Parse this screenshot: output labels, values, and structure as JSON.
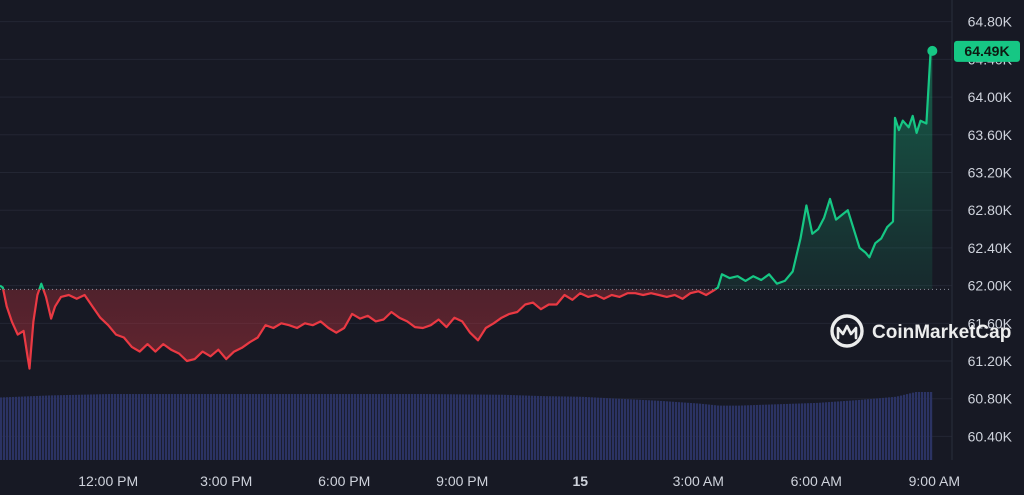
{
  "chart_data": {
    "type": "area",
    "title": "",
    "xlabel": "",
    "ylabel": "",
    "ylim": [
      60.15,
      65.03
    ],
    "y_unit_suffix": "K",
    "baseline_value": 61.96,
    "y_ticks": [
      "64.80K",
      "64.40K",
      "64.00K",
      "63.60K",
      "63.20K",
      "62.80K",
      "62.40K",
      "62.00K",
      "61.60K",
      "61.20K",
      "60.80K",
      "60.40K"
    ],
    "y_tick_values": [
      64.8,
      64.4,
      64.0,
      63.6,
      63.2,
      62.8,
      62.4,
      62.0,
      61.6,
      61.2,
      60.8,
      60.4
    ],
    "x_ticks": [
      {
        "label": "12:00 PM",
        "hour": 12
      },
      {
        "label": "3:00 PM",
        "hour": 15
      },
      {
        "label": "6:00 PM",
        "hour": 18
      },
      {
        "label": "9:00 PM",
        "hour": 21
      },
      {
        "label": "15",
        "hour": 24,
        "bold": true
      },
      {
        "label": "3:00 AM",
        "hour": 27
      },
      {
        "label": "6:00 AM",
        "hour": 30
      },
      {
        "label": "9:00 AM",
        "hour": 33
      }
    ],
    "x_range_hours": [
      9.25,
      33.45
    ],
    "current_price_label": "64.49K",
    "grid": true,
    "colors": {
      "up": "#16c784",
      "down": "#ea3943",
      "volume": "#2b3363",
      "badge": "#16c784",
      "background": "#171924"
    },
    "series": [
      {
        "values": [
          [
            9.25,
            62.0
          ],
          [
            9.32,
            61.98
          ],
          [
            9.42,
            61.78
          ],
          [
            9.55,
            61.62
          ],
          [
            9.7,
            61.48
          ],
          [
            9.85,
            61.52
          ],
          [
            9.95,
            61.25
          ],
          [
            10.0,
            61.12
          ],
          [
            10.1,
            61.62
          ],
          [
            10.2,
            61.9
          ],
          [
            10.3,
            62.02
          ],
          [
            10.42,
            61.88
          ],
          [
            10.55,
            61.65
          ],
          [
            10.65,
            61.78
          ],
          [
            10.8,
            61.88
          ],
          [
            11.0,
            61.9
          ],
          [
            11.2,
            61.86
          ],
          [
            11.4,
            61.9
          ],
          [
            11.6,
            61.78
          ],
          [
            11.8,
            61.66
          ],
          [
            12.0,
            61.58
          ],
          [
            12.2,
            61.48
          ],
          [
            12.4,
            61.45
          ],
          [
            12.6,
            61.35
          ],
          [
            12.8,
            61.3
          ],
          [
            13.0,
            61.38
          ],
          [
            13.2,
            61.3
          ],
          [
            13.4,
            61.38
          ],
          [
            13.6,
            61.32
          ],
          [
            13.8,
            61.28
          ],
          [
            14.0,
            61.2
          ],
          [
            14.2,
            61.22
          ],
          [
            14.4,
            61.3
          ],
          [
            14.6,
            61.25
          ],
          [
            14.8,
            61.32
          ],
          [
            15.0,
            61.22
          ],
          [
            15.2,
            61.3
          ],
          [
            15.4,
            61.34
          ],
          [
            15.6,
            61.4
          ],
          [
            15.8,
            61.45
          ],
          [
            16.0,
            61.58
          ],
          [
            16.2,
            61.55
          ],
          [
            16.4,
            61.6
          ],
          [
            16.6,
            61.58
          ],
          [
            16.8,
            61.55
          ],
          [
            17.0,
            61.6
          ],
          [
            17.2,
            61.58
          ],
          [
            17.4,
            61.62
          ],
          [
            17.6,
            61.55
          ],
          [
            17.8,
            61.5
          ],
          [
            18.0,
            61.55
          ],
          [
            18.2,
            61.7
          ],
          [
            18.4,
            61.65
          ],
          [
            18.6,
            61.68
          ],
          [
            18.8,
            61.62
          ],
          [
            19.0,
            61.64
          ],
          [
            19.2,
            61.72
          ],
          [
            19.4,
            61.66
          ],
          [
            19.6,
            61.62
          ],
          [
            19.8,
            61.56
          ],
          [
            20.0,
            61.55
          ],
          [
            20.2,
            61.58
          ],
          [
            20.4,
            61.64
          ],
          [
            20.6,
            61.56
          ],
          [
            20.8,
            61.66
          ],
          [
            21.0,
            61.62
          ],
          [
            21.2,
            61.5
          ],
          [
            21.4,
            61.42
          ],
          [
            21.6,
            61.55
          ],
          [
            21.8,
            61.6
          ],
          [
            22.0,
            61.66
          ],
          [
            22.2,
            61.7
          ],
          [
            22.4,
            61.72
          ],
          [
            22.6,
            61.8
          ],
          [
            22.8,
            61.82
          ],
          [
            23.0,
            61.75
          ],
          [
            23.2,
            61.8
          ],
          [
            23.4,
            61.8
          ],
          [
            23.6,
            61.9
          ],
          [
            23.8,
            61.85
          ],
          [
            24.0,
            61.92
          ],
          [
            24.2,
            61.88
          ],
          [
            24.4,
            61.9
          ],
          [
            24.6,
            61.86
          ],
          [
            24.8,
            61.9
          ],
          [
            25.0,
            61.88
          ],
          [
            25.2,
            61.92
          ],
          [
            25.4,
            61.92
          ],
          [
            25.6,
            61.9
          ],
          [
            25.8,
            61.92
          ],
          [
            26.0,
            61.9
          ],
          [
            26.2,
            61.88
          ],
          [
            26.4,
            61.9
          ],
          [
            26.6,
            61.86
          ],
          [
            26.8,
            61.92
          ],
          [
            27.0,
            61.94
          ],
          [
            27.2,
            61.9
          ],
          [
            27.4,
            61.95
          ],
          [
            27.5,
            61.98
          ],
          [
            27.6,
            62.12
          ],
          [
            27.8,
            62.08
          ],
          [
            28.0,
            62.1
          ],
          [
            28.2,
            62.05
          ],
          [
            28.4,
            62.1
          ],
          [
            28.6,
            62.06
          ],
          [
            28.8,
            62.12
          ],
          [
            29.0,
            62.02
          ],
          [
            29.2,
            62.05
          ],
          [
            29.4,
            62.15
          ],
          [
            29.6,
            62.5
          ],
          [
            29.75,
            62.85
          ],
          [
            29.9,
            62.55
          ],
          [
            30.05,
            62.6
          ],
          [
            30.2,
            62.72
          ],
          [
            30.35,
            62.92
          ],
          [
            30.5,
            62.7
          ],
          [
            30.65,
            62.75
          ],
          [
            30.8,
            62.8
          ],
          [
            30.95,
            62.6
          ],
          [
            31.1,
            62.4
          ],
          [
            31.25,
            62.35
          ],
          [
            31.35,
            62.3
          ],
          [
            31.5,
            62.45
          ],
          [
            31.65,
            62.5
          ],
          [
            31.8,
            62.62
          ],
          [
            31.95,
            62.68
          ],
          [
            32.0,
            63.78
          ],
          [
            32.1,
            63.65
          ],
          [
            32.2,
            63.75
          ],
          [
            32.35,
            63.68
          ],
          [
            32.45,
            63.8
          ],
          [
            32.55,
            63.62
          ],
          [
            32.65,
            63.75
          ],
          [
            32.8,
            63.72
          ],
          [
            32.9,
            64.45
          ],
          [
            32.95,
            64.49
          ]
        ]
      }
    ],
    "volume": [
      [
        9.25,
        0.92
      ],
      [
        10.5,
        0.95
      ],
      [
        12.0,
        0.97
      ],
      [
        14.0,
        0.97
      ],
      [
        16.0,
        0.97
      ],
      [
        18.0,
        0.97
      ],
      [
        20.0,
        0.97
      ],
      [
        22.0,
        0.96
      ],
      [
        23.0,
        0.94
      ],
      [
        24.0,
        0.93
      ],
      [
        25.0,
        0.9
      ],
      [
        26.0,
        0.87
      ],
      [
        27.0,
        0.83
      ],
      [
        27.5,
        0.8
      ],
      [
        28.0,
        0.8
      ],
      [
        29.0,
        0.82
      ],
      [
        30.0,
        0.84
      ],
      [
        31.0,
        0.88
      ],
      [
        32.0,
        0.93
      ],
      [
        32.5,
        1.0
      ],
      [
        32.95,
        1.0
      ]
    ]
  },
  "watermark": {
    "text": "CoinMarketCap",
    "icon": "coinmarketcap-logo"
  }
}
